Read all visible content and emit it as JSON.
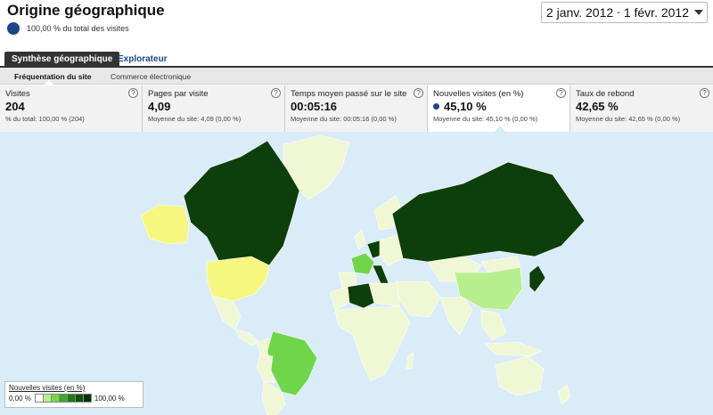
{
  "header": {
    "title": "Origine géographique",
    "subtitle": "100,00 % du total des visites"
  },
  "date_range": {
    "start": "2 janv. 2012",
    "separator": "-",
    "end": "1 févr. 2012"
  },
  "tabs": [
    {
      "label": "Synthèse géographique",
      "active": true
    },
    {
      "label": "Explorateur",
      "active": false
    }
  ],
  "subtabs": [
    {
      "label": "Fréquentation du site",
      "active": true
    },
    {
      "label": "Commerce électronique",
      "active": false
    }
  ],
  "metrics": [
    {
      "label": "Visites",
      "value": "204",
      "sub": "% du total: 100,00 % (204)",
      "selected": false
    },
    {
      "label": "Pages par visite",
      "value": "4,09",
      "sub": "Moyenne du site: 4,09 (0,00 %)",
      "selected": false
    },
    {
      "label": "Temps moyen passé sur le site",
      "value": "00:05:16",
      "sub": "Moyenne du site: 00:05:16 (0,00 %)",
      "selected": false
    },
    {
      "label": "Nouvelles visites (en %)",
      "value": "45,10 %",
      "sub": "Moyenne du site: 45,10 % (0,00 %)",
      "selected": true
    },
    {
      "label": "Taux de rebond",
      "value": "42,65 %",
      "sub": "Moyenne du site: 42,65 % (0,00 %)",
      "selected": false
    }
  ],
  "help_icon_glyph": "?",
  "legend": {
    "title": "Nouvelles visites (en %)",
    "min_label": "0,00 %",
    "max_label": "100,00 %",
    "colors": [
      "#ffffff",
      "#b7ef8e",
      "#74d94a",
      "#3faa25",
      "#1f7a14",
      "#11520c",
      "#0a3307"
    ]
  },
  "colors": {
    "accent": "#1c4587",
    "ocean": "#d9ecf8",
    "land_base": "#f0f7d4",
    "yellow": "#f6f77e",
    "green_mid": "#6fd64a",
    "green_light": "#b7ef8e",
    "green_dark": "#0d3f0a"
  }
}
